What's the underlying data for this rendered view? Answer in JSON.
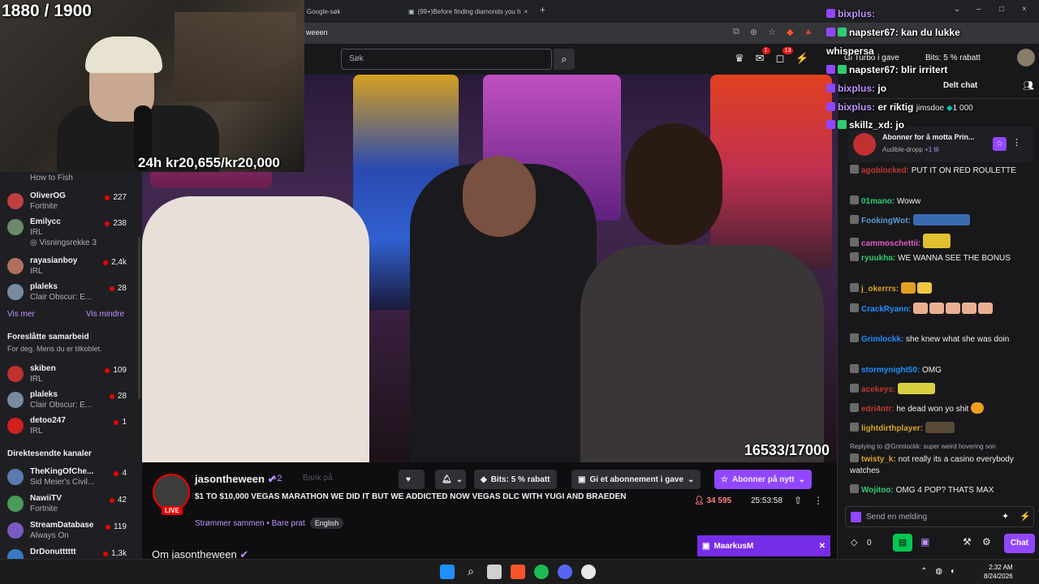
{
  "overlay": {
    "goal_counter": "1880 / 1900",
    "subathon": "24h kr20,655/kr20,000",
    "video_counter": "16533/17000"
  },
  "browser": {
    "tab1": "Google-søk",
    "tab2": "(99+)Before finding diamonds you h",
    "address": "weeen"
  },
  "nav": {
    "search_placeholder": "Søk",
    "notif_badge_1": "1",
    "notif_badge_2": "13",
    "turbo": "Gi Turbo i gave",
    "bits": "Bits: 5 % rabatt"
  },
  "sidebar": {
    "top_partial": "How to Fish",
    "channels": [
      {
        "name": "OliverOG",
        "category": "Fortnite",
        "viewers": "227",
        "color": "#c04040"
      },
      {
        "name": "Emilycc",
        "category": "IRL",
        "viewers": "238",
        "color": "#6a8a6a",
        "extra": "Visningsrekke 3"
      },
      {
        "name": "rayasianboy",
        "category": "IRL",
        "viewers": "2,4k",
        "color": "#b07060"
      },
      {
        "name": "plaleks",
        "category": "Clair Obscur: E...",
        "viewers": "28",
        "color": "#7a8aa0"
      }
    ],
    "show_more": "Vis mer",
    "show_less": "Vis mindre",
    "collab_heading": "Foreslåtte samarbeid",
    "collab_sub": "For deg. Mens du er tilkoblet.",
    "collab": [
      {
        "name": "skiben",
        "category": "IRL",
        "viewers": "109",
        "color": "#c03030"
      },
      {
        "name": "plaleks",
        "category": "Clair Obscur: E...",
        "viewers": "28",
        "color": "#7a8aa0"
      },
      {
        "name": "detoo247",
        "category": "IRL",
        "viewers": "1",
        "color": "#d02020"
      }
    ],
    "direct_heading": "Direktesendte kanaler",
    "direct": [
      {
        "name": "TheKingOfChe...",
        "category": "Sid Meier's Civil...",
        "viewers": "4",
        "color": "#5a7ab0"
      },
      {
        "name": "NawiiTV",
        "category": "Fortnite",
        "viewers": "42",
        "color": "#4a9a5a"
      },
      {
        "name": "StreamDatabase",
        "category": "Always On",
        "viewers": "119",
        "color": "#7a5ac0"
      },
      {
        "name": "DrDonutttttt",
        "category": "",
        "viewers": "1,3k",
        "color": "#3a7ac0"
      }
    ]
  },
  "stream": {
    "streamer": "jasontheween",
    "plus": "+2",
    "bank": "Bank på",
    "title": "$1 TO $10,000 VEGAS MARATHON WE DID IT BUT WE ADDICTED NOW VEGAS DLC WITH YUGI AND BRAEDEN",
    "category": "Strømmer sammen • Bare prat",
    "tag": "English",
    "live": "LIVE",
    "bits_btn": "Bits: 5 % rabatt",
    "gift_btn": "Gi et abonnement i gave",
    "resub_btn": "Abonner på nytt",
    "viewers": "34 595",
    "uptime": "25:53:58",
    "about": "Om jasontheween",
    "mini_user": "MaarkusM"
  },
  "chat": {
    "shared": "Delt chat",
    "promo_title": "Abonner for å motta Prin...",
    "promo_sub": "Audible-dropp",
    "promo_more": "+1 til",
    "messages": [
      {
        "user": "agoblocked:",
        "text": "PUT IT ON RED ROULETTE",
        "color": "#c0392b"
      },
      {
        "user": "01mano:",
        "text": "Woww",
        "color": "#2ecc71"
      },
      {
        "user": "FookingWot:",
        "text": "",
        "color": "#5b9bd5"
      },
      {
        "user": "cammoschettii:",
        "text": "",
        "color": "#e05ac0"
      },
      {
        "user": "ryuukha:",
        "text": "WE WANNA SEE THE BONUS",
        "color": "#2ecc71"
      },
      {
        "user": "j_okerrrs:",
        "text": "",
        "color": "#daa520"
      },
      {
        "user": "CrackRyann:",
        "text": "",
        "color": "#1e90ff"
      },
      {
        "user": "Grimlockk:",
        "text": "she knew what she was doin",
        "color": "#1e90ff"
      },
      {
        "user": "stormynight50:",
        "text": "OMG",
        "color": "#1e90ff"
      },
      {
        "user": "acekeys:",
        "text": "",
        "color": "#c0392b"
      },
      {
        "user": "edri4ntr:",
        "text": "he dead won yo shit",
        "color": "#c0392b"
      },
      {
        "user": "lightdirthplayer:",
        "text": "",
        "color": "#daa520"
      },
      {
        "user": "twisty_k:",
        "text": "not really its a casino everybody watches",
        "color": "#daa520"
      },
      {
        "user": "Wojitoo:",
        "text": "OMG 4 POP? THATS MAX",
        "color": "#2ecc71"
      }
    ],
    "reply": "Replying to @Grimlockk: super weird hovering son",
    "input_placeholder": "Send en melding",
    "points": "0",
    "chat_button": "Chat"
  },
  "overlay_chat": [
    {
      "user": "bixplus:",
      "text": ""
    },
    {
      "user": "napster67:",
      "text": "kan du lukke"
    },
    {
      "user": "whispersa",
      "text": ""
    },
    {
      "user": "napster67:",
      "text": "blir irritert"
    },
    {
      "user": "bixplus:",
      "text": "jo"
    },
    {
      "user": "bixplus:",
      "text": "er riktig"
    },
    {
      "user": "skillz_xd:",
      "text": "jo"
    }
  ],
  "overlay_extra": {
    "jimsdoe": "jimsdoe",
    "jimsdoe_pts": "1 000"
  },
  "taskbar": {
    "time": "2:32 AM",
    "date": "8/24/2026"
  }
}
